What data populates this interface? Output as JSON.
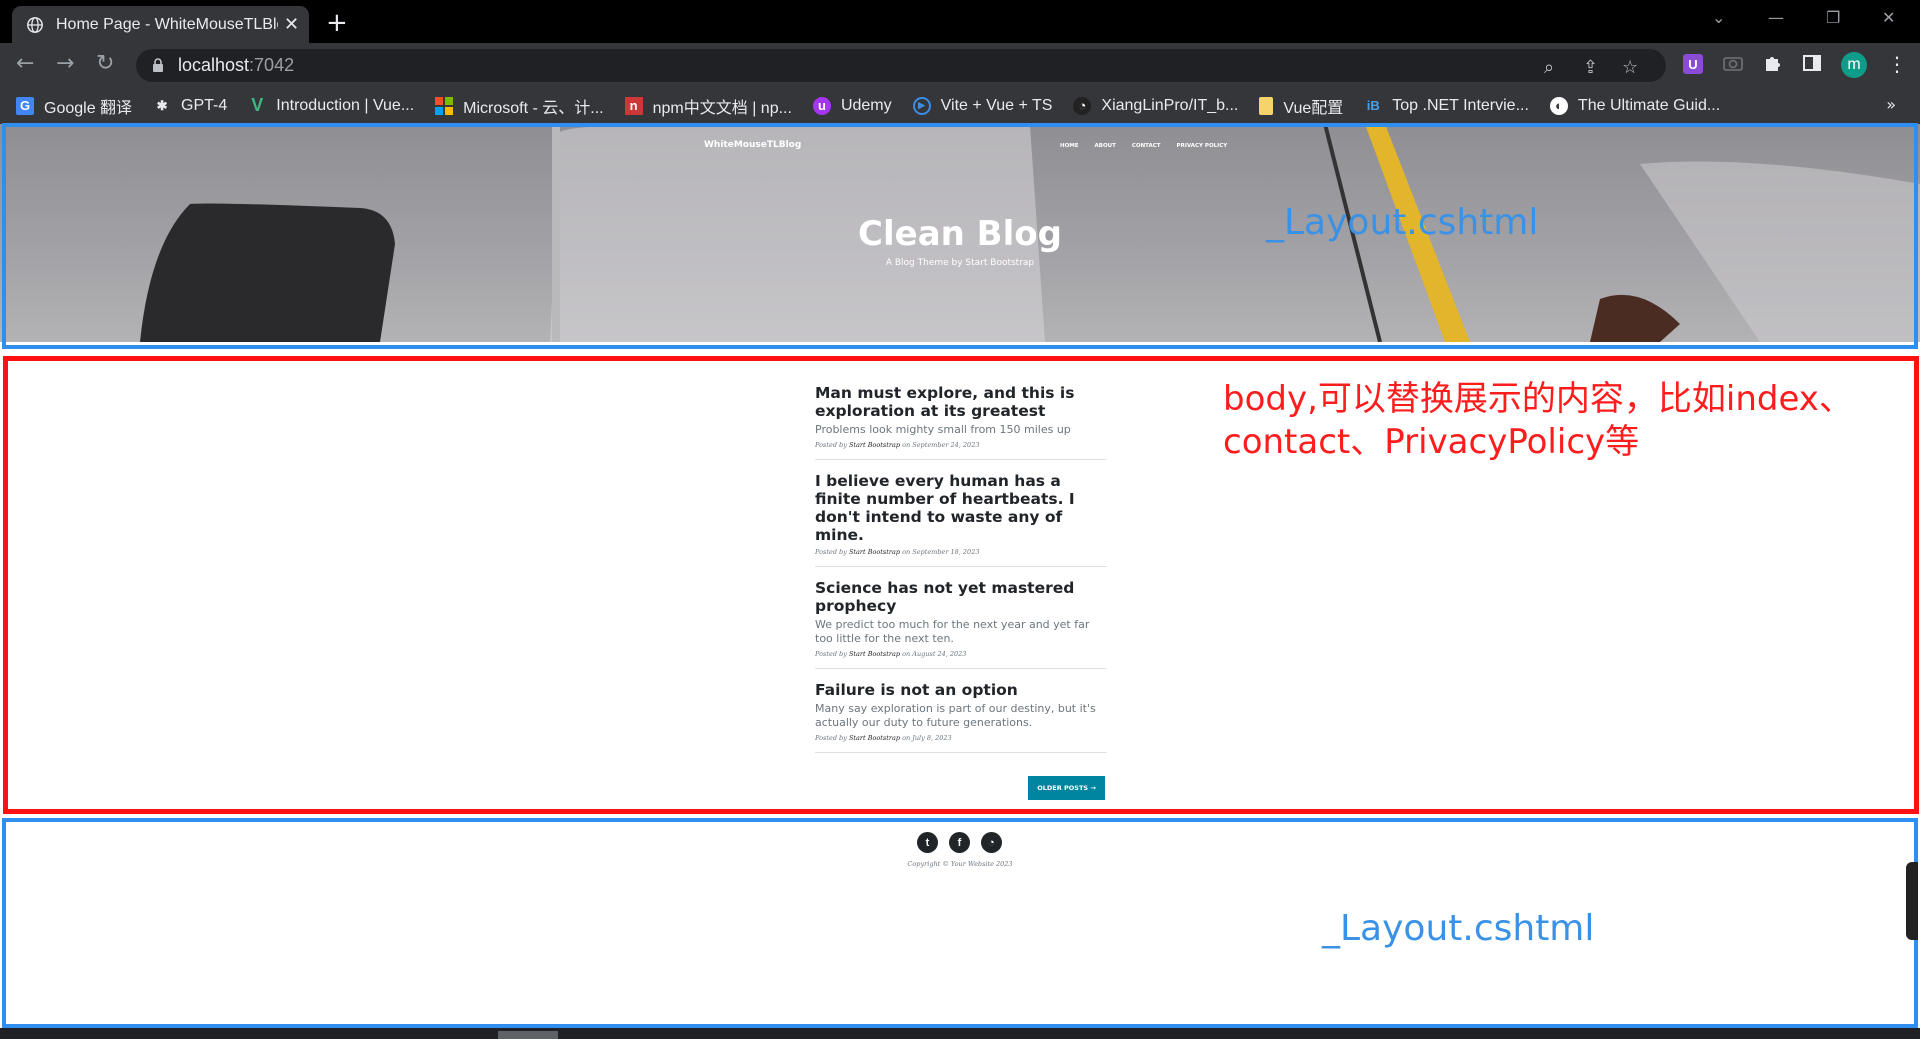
{
  "browser": {
    "tab_title": "Home Page - WhiteMouseTLBlog",
    "url_host": "localhost",
    "url_port": ":7042",
    "profile_initial": "m",
    "bookmarks": [
      {
        "label": "Google 翻译",
        "icon": "google-translate-icon"
      },
      {
        "label": "GPT-4",
        "icon": "openai-icon"
      },
      {
        "label": "Introduction | Vue...",
        "icon": "vue-icon"
      },
      {
        "label": "Microsoft - 云、计...",
        "icon": "microsoft-icon"
      },
      {
        "label": "npm中文文档 | np...",
        "icon": "npm-icon"
      },
      {
        "label": "Udemy",
        "icon": "udemy-icon"
      },
      {
        "label": "Vite + Vue + TS",
        "icon": "vite-icon"
      },
      {
        "label": "XiangLinPro/IT_b...",
        "icon": "github-icon"
      },
      {
        "label": "Vue配置",
        "icon": "folder-icon"
      },
      {
        "label": "Top .NET Intervie...",
        "icon": "ib-icon"
      },
      {
        "label": "The Ultimate Guid...",
        "icon": "globe-icon"
      }
    ],
    "more_bookmarks": "»"
  },
  "masthead": {
    "brand": "WhiteMouseTLBlog",
    "nav": [
      "HOME",
      "ABOUT",
      "CONTACT",
      "PRIVACY POLICY"
    ],
    "heading": "Clean Blog",
    "subheading": "A Blog Theme by Start Bootstrap"
  },
  "annotations": {
    "layout_top": "_Layout.cshtml",
    "body_line1": "body,可以替换展示的内容，比如index、",
    "body_line2": "contact、PrivacyPolicy等",
    "layout_bottom": "_Layout.cshtml"
  },
  "posts": [
    {
      "title": "Man must explore, and this is exploration at its greatest",
      "subtitle": "Problems look mighty small from 150 miles up",
      "meta_prefix": "Posted by",
      "author": "Start Bootstrap",
      "date": "on September 24, 2023"
    },
    {
      "title": "I believe every human has a finite number of heartbeats. I don't intend to waste any of mine.",
      "subtitle": "",
      "meta_prefix": "Posted by",
      "author": "Start Bootstrap",
      "date": "on September 18, 2023"
    },
    {
      "title": "Science has not yet mastered prophecy",
      "subtitle": "We predict too much for the next year and yet far too little for the next ten.",
      "meta_prefix": "Posted by",
      "author": "Start Bootstrap",
      "date": "on August 24, 2023"
    },
    {
      "title": "Failure is not an option",
      "subtitle": "Many say exploration is part of our destiny, but it's actually our duty to future generations.",
      "meta_prefix": "Posted by",
      "author": "Start Bootstrap",
      "date": "on July 8, 2023"
    }
  ],
  "older_posts": "OLDER POSTS →",
  "footer": {
    "social": [
      "twitter-icon",
      "facebook-icon",
      "github-icon"
    ],
    "copyright": "Copyright © Your Website 2023"
  },
  "colors": {
    "annotation_blue": "#2f8ff0",
    "annotation_red": "#ff1111",
    "button": "#0085a1"
  }
}
